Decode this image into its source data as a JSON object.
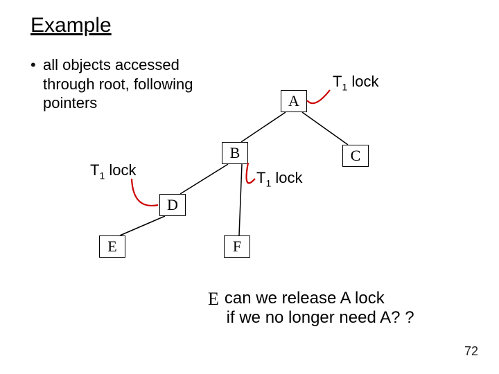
{
  "title": "Example",
  "bullet": {
    "marker": "•",
    "text": "all objects accessed through root, following pointers"
  },
  "nodes": {
    "A": "A",
    "B": "B",
    "C": "C",
    "D": "D",
    "E": "E",
    "F": "F"
  },
  "labels": {
    "t1_A": {
      "t": "T",
      "sub": "1",
      "rest": " lock"
    },
    "t1_B": {
      "t": "T",
      "sub": "1",
      "rest": " lock"
    },
    "t1_D": {
      "t": "T",
      "sub": "1",
      "rest": " lock"
    }
  },
  "question": {
    "hand": "E",
    "line1": "can we release A lock",
    "line2": "if we no longer need A? ?"
  },
  "page": "72",
  "colors": {
    "lockcurve": "#cc0000"
  }
}
